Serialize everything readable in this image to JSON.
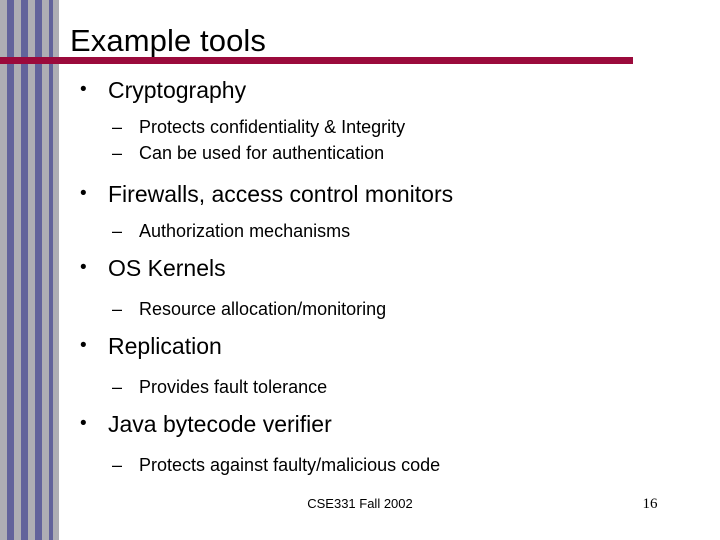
{
  "slide": {
    "title": "Example tools",
    "accent_color": "#9b0a3c",
    "stripe_gray": "#aeaeb4",
    "stripe_purple": "#62639b",
    "text_color": "#000000",
    "background_color": "#ffffff"
  },
  "bullet_glyphs": {
    "level1": "•",
    "level2": "–"
  },
  "content": [
    {
      "level": 1,
      "text": "Cryptography"
    },
    {
      "level": 2,
      "text": "Protects confidentiality & Integrity"
    },
    {
      "level": 2,
      "text": "Can be used for authentication"
    },
    {
      "level": 1,
      "text": "Firewalls, access control monitors"
    },
    {
      "level": 2,
      "text": "Authorization mechanisms"
    },
    {
      "level": 1,
      "text": "OS Kernels"
    },
    {
      "level": 2,
      "text": "Resource allocation/monitoring"
    },
    {
      "level": 1,
      "text": "Replication"
    },
    {
      "level": 2,
      "text": "Provides fault tolerance"
    },
    {
      "level": 1,
      "text": "Java bytecode verifier"
    },
    {
      "level": 2,
      "text": "Protects against faulty/malicious code"
    }
  ],
  "footer": {
    "course": "CSE331 Fall 2002",
    "page_number": "16"
  }
}
